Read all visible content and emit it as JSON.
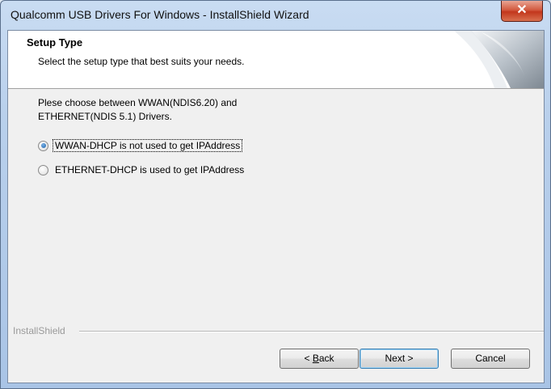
{
  "window": {
    "title": "Qualcomm USB Drivers For Windows - InstallShield Wizard",
    "close_glyph": "✕"
  },
  "banner": {
    "title": "Setup Type",
    "subtitle": "Select the setup type that best suits your needs."
  },
  "body": {
    "description_line1": "Plese choose between WWAN(NDIS6.20) and",
    "description_line2": "ETHERNET(NDIS 5.1) Drivers.",
    "options": [
      {
        "label": "WWAN-DHCP is not used to get IPAddress",
        "selected": true
      },
      {
        "label": "ETHERNET-DHCP is used to get IPAddress",
        "selected": false
      }
    ]
  },
  "footer": {
    "brand": "InstallShield",
    "back_prefix": "< ",
    "back_accel": "B",
    "back_rest": "ack",
    "next_label": "Next >",
    "cancel_label": "Cancel"
  },
  "colors": {
    "accent": "#3c7fb1",
    "close_red": "#c3371c"
  }
}
